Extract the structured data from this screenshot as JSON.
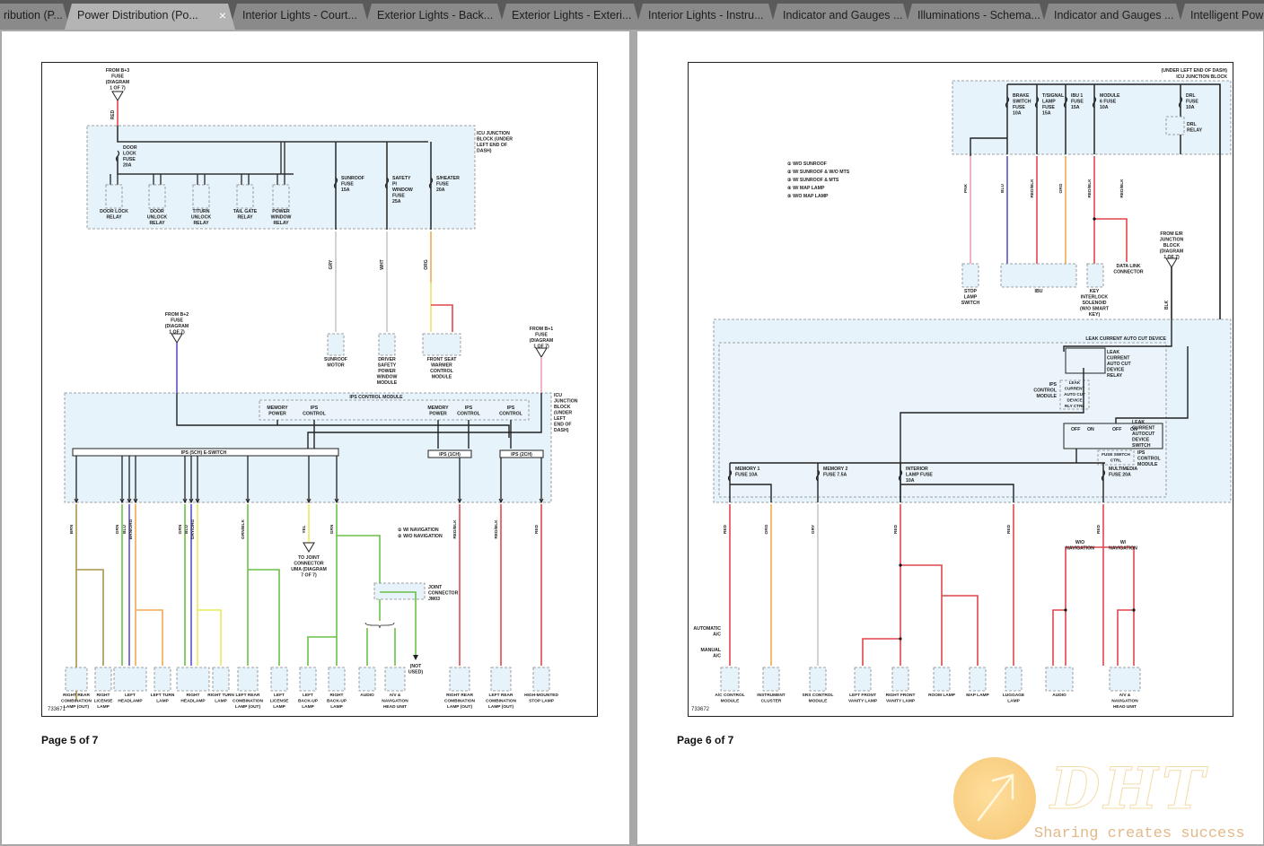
{
  "tabs": [
    {
      "label": "ribution (P...",
      "active": false
    },
    {
      "label": "Power Distribution (Po...",
      "active": true
    },
    {
      "label": "Interior Lights - Court...",
      "active": false
    },
    {
      "label": "Exterior Lights - Back...",
      "active": false
    },
    {
      "label": "Exterior Lights - Exteri...",
      "active": false
    },
    {
      "label": "Interior Lights - Instru...",
      "active": false
    },
    {
      "label": "Indicator and Gauges ...",
      "active": false
    },
    {
      "label": "Illuminations - Schema...",
      "active": false
    },
    {
      "label": "Indicator and Gauges ...",
      "active": false
    },
    {
      "label": "Intelligent Pow",
      "active": false
    }
  ],
  "close_glyph": "×",
  "pages": {
    "p5": {
      "label": "Page 5 of 7",
      "figure_no": "733671",
      "source_top": "FROM B+3 FUSE (DIAGRAM 1 OF 7)",
      "source_top_wire": "RED",
      "source_b2": "FROM B+2 FUSE (DIAGRAM 1 OF 7)",
      "source_b1": "FROM B+1 FUSE (DIAGRAM 1 OF 7)",
      "junction_block": "ICU JUNCTION BLOCK (UNDER LEFT END OF DASH)",
      "fuses": [
        "DOOR LOCK FUSE 20A",
        "SUNROOF FUSE 15A",
        "SAFETY PI WINDOW FUSE 25A",
        "S/HEATER FUSE 20A"
      ],
      "relays": [
        "DOOR LOCK RELAY",
        "DOOR UNLOCK RELAY",
        "T/TURN UNLOCK RELAY",
        "TAIL GATE RELAY",
        "POWER WINDOW RELAY"
      ],
      "mid_components": [
        "SUNROOF MOTOR",
        "DRIVER SAFETY POWER WINDOW MODULE",
        "FRONT SEAT WARMER CONTROL MODULE"
      ],
      "mid_wires": [
        "GRY",
        "WHT",
        "ORG",
        "YEL",
        "RED"
      ],
      "ips_module": "IPS CONTROL MODULE",
      "ips_functions": [
        "MEMORY POWER",
        "IPS CONTROL",
        "MEMORY POWER",
        "IPS CONTROL",
        "IPS CONTROL"
      ],
      "ips_switches": [
        "IPS (5CH) E-SWITCH",
        "IPS (1CH)",
        "IPS (2CH)"
      ],
      "legend": [
        "W/ NAVIGATION",
        "W/O NAVIGATION"
      ],
      "joint_connector": "JOINT CONNECTOR JM03",
      "to_joint": "TO JOINT CONNECTOR UMA (DIAGRAM 7 OF 7)",
      "not_used": "(NOT USED)",
      "bottom_components": [
        "RIGHT REAR COMBINATION LAMP (OUT)",
        "RIGHT LICENSE LAMP",
        "LEFT HEADLAMP",
        "LEFT TURN LAMP",
        "RIGHT HEADLAMP",
        "RIGHT TURN LAMP",
        "LEFT REAR COMBINATION LAMP (OUT)",
        "LEFT LICENSE LAMP",
        "LEFT BACK-UP LAMP",
        "RIGHT BACK-UP LAMP",
        "AUDIO",
        "A/V & NAVIGATION HEAD UNIT",
        "RIGHT REAR COMBINATION LAMP (OUT)",
        "LEFT REAR COMBINATION LAMP (OUT)",
        "HIGH-MOUNTED STOP LAMP"
      ],
      "bottom_wires": [
        "BRN",
        "GRN",
        "BLU",
        "BRN/ORG",
        "GRN",
        "BLU",
        "GRY/ORG",
        "GRN/BLK",
        "YEL",
        "GRN",
        "RED/BLK",
        "RED/BLK",
        "RED"
      ]
    },
    "p6": {
      "label": "Page 6 of 7",
      "figure_no": "733672",
      "junction_block": "(UNDER LEFT END OF DASH) ICU JUNCTION BLOCK",
      "top_fuses": [
        "BRAKE SWITCH FUSE 10A",
        "T/SIGNAL LAMP FUSE 15A",
        "IBU 1 FUSE 15A",
        "MODULE 6 FUSE 10A",
        "DRL FUSE 10A"
      ],
      "drl_relay": "DRL RELAY",
      "legend": [
        "W/O SUNROOF",
        "W/ SUNROOF & W/O MTS",
        "W/ SUNROOF & MTS",
        "W/ MAP LAMP",
        "W/O MAP LAMP"
      ],
      "top_components": [
        "STOP LAMP SWITCH",
        "IBU",
        "KEY INTERLOCK SOLENOID (W/O SMART KEY)",
        "DATA LINK CONNECTOR"
      ],
      "top_wires": [
        "PNK",
        "BLU",
        "RED/BLK",
        "ORG",
        "RED/BLK",
        "RED/BLK"
      ],
      "from_eir": "FROM E/R JUNCTION BLOCK (DIAGRAM 1 OF 7)",
      "from_eir_wire": "BLK",
      "leak_device": "LEAK CURRENT AUTO CUT DEVICE",
      "leak_relay": "LEAK CURRENT AUTO CUT DEVICE RELAY",
      "ips_ctrl_label": "IPS CONTROL MODULE",
      "rly_ctrl": "LEAK CURRENT AUTO CUT DEVICE RLY CTRL",
      "leak_switch": "LEAK CURRENT AUTOCUT DEVICE SWITCH",
      "fuse_switch_ctrl": "FUSE SWITCH CTRL",
      "off_label": "OFF",
      "on_label": "ON",
      "bottom_fuses": [
        "MEMORY 1 FUSE 10A",
        "MEMORY 2 FUSE 7.5A",
        "INTERIOR LAMP FUSE 10A",
        "MULTIMEDIA FUSE 20A"
      ],
      "ac_labels": [
        "AUTOMATIC A/C",
        "MANUAL A/C"
      ],
      "nav_labels": [
        "W/O NAVIGATION",
        "W/ NAVIGATION"
      ],
      "bottom_components": [
        "A/C CONTROL MODULE",
        "INSTRUMENT CLUSTER",
        "SRS CONTROL MODULE",
        "LEFT FRONT VANITY LAMP",
        "RIGHT FRONT VANITY LAMP",
        "ROOM LAMP",
        "MAP LAMP",
        "LUGGAGE LAMP",
        "AUDIO",
        "A/V & NAVIGATION HEAD UNIT"
      ],
      "bottom_wires": [
        "RED",
        "ORG",
        "GRY",
        "RED",
        "RED",
        "RED"
      ]
    }
  },
  "watermark": {
    "logo": "DHT",
    "tagline": "Sharing creates success"
  },
  "colors": {
    "red": "#e0474c",
    "pink": "#f2a0b4",
    "blue": "#5a52c8",
    "orange": "#f0a850",
    "yellow": "#ecea5a",
    "green": "#6cbf46",
    "brown": "#a8944a",
    "gray": "#c8c8c8",
    "block_fill": "#e6f3fa"
  }
}
